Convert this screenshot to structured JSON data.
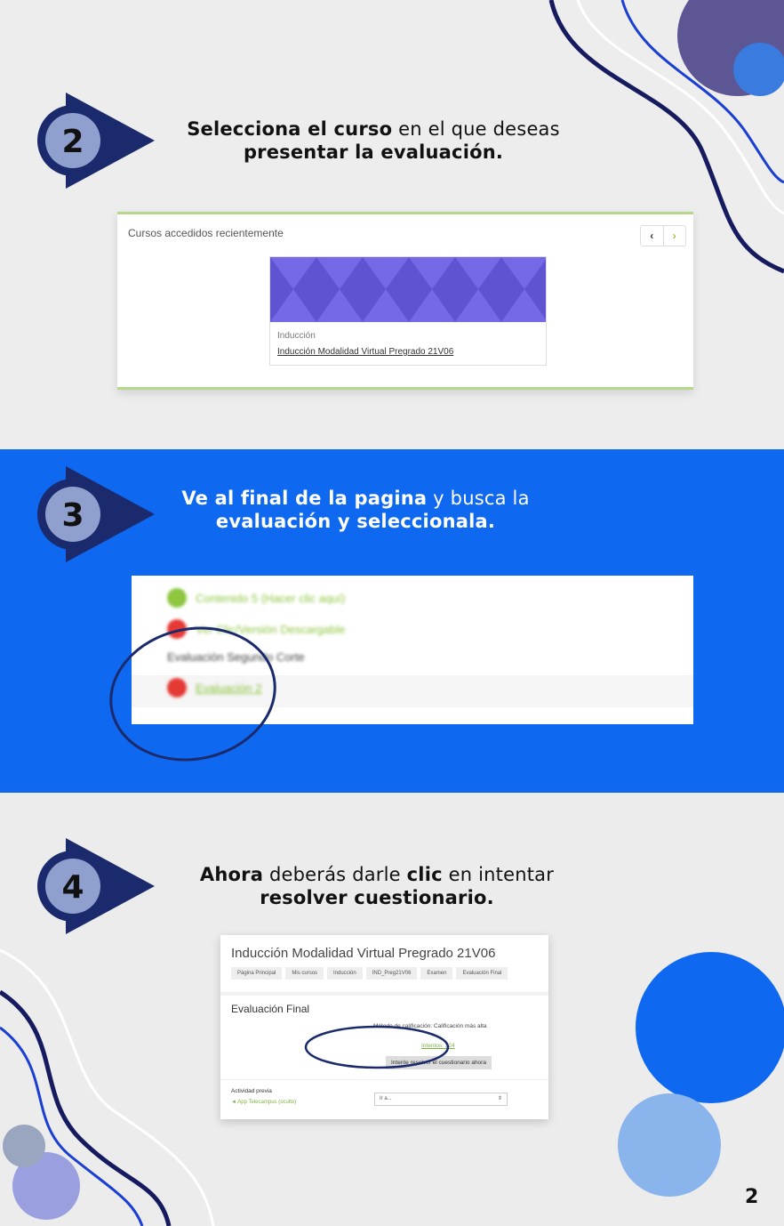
{
  "steps": [
    {
      "number": "2",
      "title_bold": "Selecciona el curso",
      "title_rest": " en el  que deseas",
      "title_line2_bold": "presentar la evaluación."
    },
    {
      "number": "3",
      "title_bold": "Ve al final de la pagina",
      "title_rest": " y busca la",
      "title_line2_bold": "evaluación y seleccionala."
    },
    {
      "number": "4",
      "title_bold": "Ahora",
      "title_mid": " deberás darle ",
      "title_bold2": "clic",
      "title_rest": " en intentar",
      "title_line2_bold": "resolver cuestionario."
    }
  ],
  "card2": {
    "header": "Cursos accedidos recientemente",
    "prev_icon": "chevron-left-icon",
    "next_icon": "chevron-right-icon",
    "prev_glyph": "‹",
    "next_glyph": "›",
    "course_category": "Inducción",
    "course_name": "Inducción Modalidad Virtual Pregrado 21V06"
  },
  "card3": {
    "items": [
      {
        "text": "Contenido 5 (Hacer clic aquí)",
        "status_color": "#8dc63f"
      },
      {
        "text": "Ver Clic/Versión Descargable",
        "status_color": "#e53935"
      },
      {
        "text": "Evaluación Segundo Corte",
        "status_color": ""
      },
      {
        "text": "Evaluación 2",
        "status_color": "#e53935"
      }
    ]
  },
  "card4": {
    "title": "Inducción Modalidad Virtual Pregrado 21V06",
    "breadcrumbs": [
      "Página Principal",
      "Mis cursos",
      "Inducción",
      "IND_Preg21V06",
      "Examen",
      "Evaluación Final"
    ],
    "quiz_title": "Evaluación Final",
    "grading_method": "Método de calificación: Calificación más alta",
    "attempts": "Intentos: 324",
    "attempt_button": "Intente resolver el cuestionario ahora",
    "previous_activity_label": "Actividad previa",
    "previous_activity_link": "◄ App Telecampus (oculto)",
    "goto_placeholder": "Ir a...",
    "goto_arrow": "⇕"
  },
  "colors": {
    "navy": "#1a2a6c",
    "blue": "#0f68f0",
    "purple": "#6b5fde",
    "green": "#b4d78a"
  },
  "page_number": "2"
}
